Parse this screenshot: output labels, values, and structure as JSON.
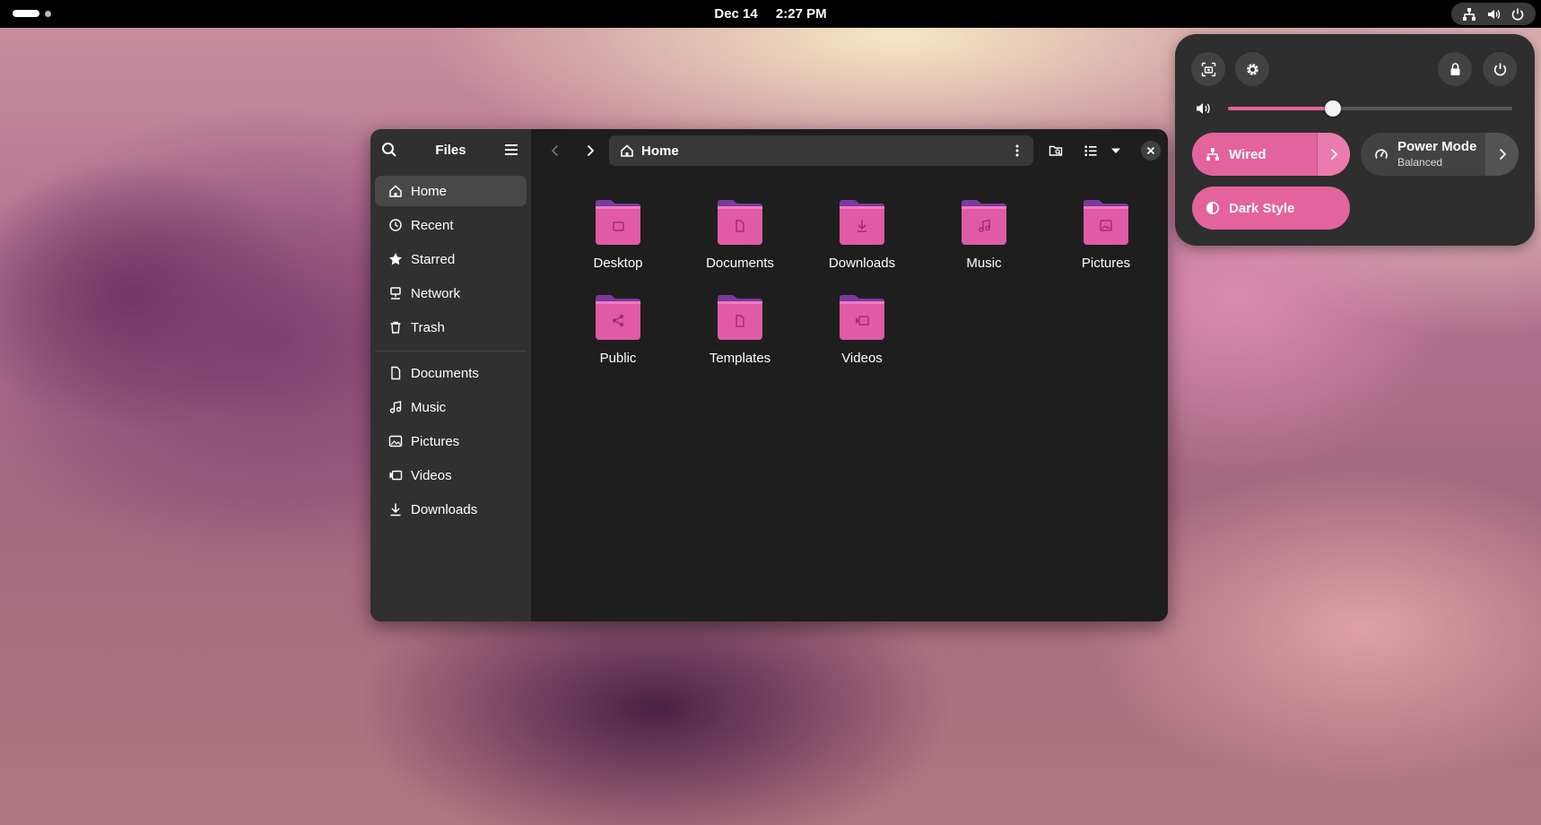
{
  "topbar": {
    "date": "Dec 14",
    "time": "2:27 PM",
    "tray_icons": [
      "network-wired-icon",
      "volume-icon",
      "power-icon"
    ]
  },
  "files": {
    "title": "Files",
    "sidebar": {
      "places": [
        {
          "label": "Home",
          "icon": "home-icon",
          "active": true
        },
        {
          "label": "Recent",
          "icon": "clock-icon"
        },
        {
          "label": "Starred",
          "icon": "star-icon"
        },
        {
          "label": "Network",
          "icon": "network-icon"
        },
        {
          "label": "Trash",
          "icon": "trash-icon"
        }
      ],
      "bookmarks": [
        {
          "label": "Documents",
          "icon": "document-icon"
        },
        {
          "label": "Music",
          "icon": "music-icon"
        },
        {
          "label": "Pictures",
          "icon": "picture-icon"
        },
        {
          "label": "Videos",
          "icon": "video-icon"
        },
        {
          "label": "Downloads",
          "icon": "download-icon"
        }
      ]
    },
    "pathbar": {
      "location": "Home"
    },
    "folders": [
      {
        "label": "Desktop",
        "emblem": "folder-emblem"
      },
      {
        "label": "Documents",
        "emblem": "document-emblem"
      },
      {
        "label": "Downloads",
        "emblem": "download-emblem"
      },
      {
        "label": "Music",
        "emblem": "music-emblem"
      },
      {
        "label": "Pictures",
        "emblem": "picture-emblem"
      },
      {
        "label": "Public",
        "emblem": "share-emblem"
      },
      {
        "label": "Templates",
        "emblem": "template-emblem"
      },
      {
        "label": "Videos",
        "emblem": "video-emblem"
      }
    ]
  },
  "quick_settings": {
    "volume_level": 0.37,
    "wired": {
      "label": "Wired",
      "active": true
    },
    "power_mode": {
      "label": "Power Mode",
      "value": "Balanced",
      "active": false
    },
    "dark_style": {
      "label": "Dark Style",
      "active": true
    }
  },
  "colors": {
    "accent": "#e3639d",
    "folder_top": "#7b3a9e",
    "folder_front": "#e05aa6",
    "window_bg": "#1e1e1e",
    "sidebar_bg": "#303030",
    "panel_bg": "#2e2e2e"
  }
}
